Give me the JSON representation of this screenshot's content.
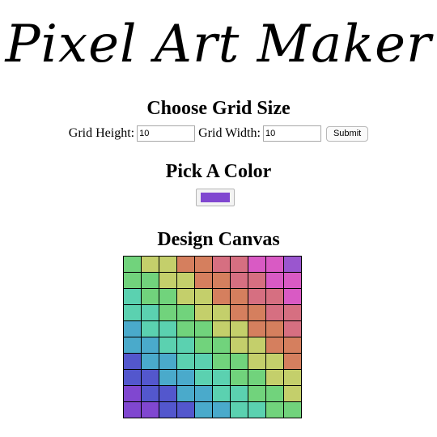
{
  "app": {
    "title": "Pixel Art Maker"
  },
  "grid_size": {
    "heading": "Choose Grid Size",
    "height_label": "Grid Height:",
    "height_value": "10",
    "width_label": "Grid Width:",
    "width_value": "10",
    "submit_label": "Submit"
  },
  "color": {
    "heading": "Pick A Color",
    "selected": "#8047D0"
  },
  "canvas": {
    "heading": "Design Canvas",
    "rows": 10,
    "cols": 10,
    "cells": [
      [
        "#71D37C",
        "#C4CF6B",
        "#C4CF6B",
        "#D57F5E",
        "#D57F5E",
        "#D66F81",
        "#D66F81",
        "#D95AC4",
        "#D95AC4",
        "#9A56CF"
      ],
      [
        "#71D37C",
        "#71D37C",
        "#C4CF6B",
        "#C4CF6B",
        "#D57F5E",
        "#D57F5E",
        "#D66F81",
        "#D66F81",
        "#D95AC4",
        "#D95AC4"
      ],
      [
        "#5BD1B0",
        "#71D37C",
        "#71D37C",
        "#C4CF6B",
        "#C4CF6B",
        "#D57F5E",
        "#D57F5E",
        "#D66F81",
        "#D66F81",
        "#D95AC4"
      ],
      [
        "#5BD1B0",
        "#5BD1B0",
        "#71D37C",
        "#71D37C",
        "#C4CF6B",
        "#C4CF6B",
        "#D57F5E",
        "#D57F5E",
        "#D66F81",
        "#D66F81"
      ],
      [
        "#4AAACB",
        "#5BD1B0",
        "#5BD1B0",
        "#71D37C",
        "#71D37C",
        "#C4CF6B",
        "#C4CF6B",
        "#D57F5E",
        "#D57F5E",
        "#D66F81"
      ],
      [
        "#4AAACB",
        "#4AAACB",
        "#5BD1B0",
        "#5BD1B0",
        "#71D37C",
        "#71D37C",
        "#C4CF6B",
        "#C4CF6B",
        "#D57F5E",
        "#D57F5E"
      ],
      [
        "#5357CD",
        "#4AAACB",
        "#4AAACB",
        "#5BD1B0",
        "#5BD1B0",
        "#71D37C",
        "#71D37C",
        "#C4CF6B",
        "#C4CF6B",
        "#D57F5E"
      ],
      [
        "#5357CD",
        "#5357CD",
        "#4AAACB",
        "#4AAACB",
        "#5BD1B0",
        "#5BD1B0",
        "#71D37C",
        "#71D37C",
        "#C4CF6B",
        "#C4CF6B"
      ],
      [
        "#8047D0",
        "#5357CD",
        "#5357CD",
        "#4AAACB",
        "#4AAACB",
        "#5BD1B0",
        "#5BD1B0",
        "#71D37C",
        "#71D37C",
        "#C4CF6B"
      ],
      [
        "#8047D0",
        "#8047D0",
        "#5357CD",
        "#5357CD",
        "#4AAACB",
        "#4AAACB",
        "#5BD1B0",
        "#5BD1B0",
        "#71D37C",
        "#71D37C"
      ]
    ]
  }
}
